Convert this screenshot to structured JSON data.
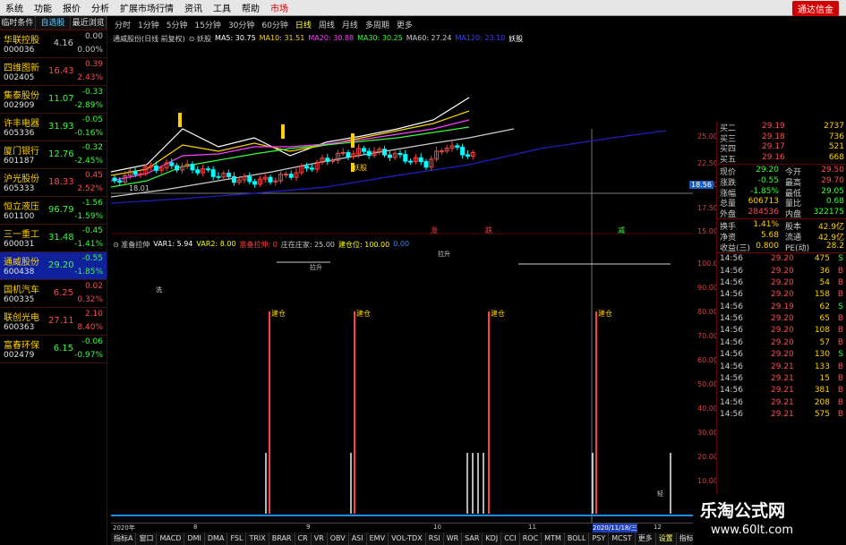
{
  "menu": {
    "items": [
      "系统",
      "功能",
      "报价",
      "分析",
      "扩展市场行情",
      "资讯",
      "工具",
      "帮助"
    ],
    "active": "市场",
    "broker": "通达信金"
  },
  "left_tabs": [
    "临时条件",
    "自选股",
    "最近浏览"
  ],
  "stocks": [
    {
      "name": "华联控股",
      "code": "000036",
      "price": "4.16",
      "change": "0.00",
      "pct": "0.00%",
      "dir": "flat"
    },
    {
      "name": "四维图新",
      "code": "002405",
      "price": "16.43",
      "change": "0.39",
      "pct": "2.43%",
      "dir": "up"
    },
    {
      "name": "集泰股份",
      "code": "002909",
      "price": "11.07",
      "change": "-0.33",
      "pct": "-2.89%",
      "dir": "dn"
    },
    {
      "name": "许丰电器",
      "code": "605336",
      "price": "31.93",
      "change": "-0.05",
      "pct": "-0.16%",
      "dir": "dn"
    },
    {
      "name": "厦门银行",
      "code": "601187",
      "price": "12.76",
      "change": "-0.32",
      "pct": "-2.45%",
      "dir": "dn"
    },
    {
      "name": "沪光股份",
      "code": "605333",
      "price": "18.33",
      "change": "0.45",
      "pct": "2.52%",
      "dir": "up"
    },
    {
      "name": "恒立液压",
      "code": "601100",
      "price": "96.79",
      "change": "-1.56",
      "pct": "-1.59%",
      "dir": "dn"
    },
    {
      "name": "三一重工",
      "code": "600031",
      "price": "31.48",
      "change": "-0.45",
      "pct": "-1.41%",
      "dir": "dn"
    },
    {
      "name": "通威股份",
      "code": "600438",
      "price": "29.20",
      "change": "-0.55",
      "pct": "-1.85%",
      "dir": "dn",
      "selected": true
    },
    {
      "name": "国机汽车",
      "code": "600335",
      "price": "6.25",
      "change": "0.02",
      "pct": "0.32%",
      "dir": "up"
    },
    {
      "name": "联创光电",
      "code": "600363",
      "price": "27.11",
      "change": "2.10",
      "pct": "8.40%",
      "dir": "up"
    },
    {
      "name": "富春环保",
      "code": "002479",
      "price": "6.15",
      "change": "-0.06",
      "pct": "-0.97%",
      "dir": "dn"
    }
  ],
  "periods": [
    "分时",
    "1分钟",
    "5分钟",
    "15分钟",
    "30分钟",
    "60分钟",
    "日线",
    "周线",
    "月线",
    "多周期",
    "更多"
  ],
  "period_active": "日线",
  "ma_legend": [
    {
      "text": "通威股份(日线 前复权)",
      "color": "#cccccc"
    },
    {
      "text": "⊙ 妖股",
      "color": "#cccccc"
    },
    {
      "text": "MA5: 30.75",
      "color": "#ffffff"
    },
    {
      "text": "MA10: 31.51",
      "color": "#ffd100"
    },
    {
      "text": "MA20: 30.88",
      "color": "#ff40ff"
    },
    {
      "text": "MA30: 30.25",
      "color": "#36ff36"
    },
    {
      "text": "MA60: 27.24",
      "color": "#cccccc"
    },
    {
      "text": "MA120: 23.10",
      "color": "#4040ff"
    },
    {
      "text": "妖股",
      "color": "#ffffff"
    }
  ],
  "ind_legend": [
    {
      "text": "⊙ 准备拉伸",
      "color": "#cccccc"
    },
    {
      "text": "VAR1: 5.94",
      "color": "#ffffff"
    },
    {
      "text": "VAR2: 8.00",
      "color": "#ffff00"
    },
    {
      "text": "准备拉伸: 0",
      "color": "#ff4040"
    },
    {
      "text": "庄在庄家: 25.00",
      "color": "#cccccc"
    },
    {
      "text": "建仓位: 100.00",
      "color": "#ffff00"
    },
    {
      "text": "0.00",
      "color": "#4080ff"
    }
  ],
  "chart_labels": {
    "yao": "妖股",
    "low": "18.01",
    "cur": "18.56",
    "jc": "建仓",
    "ind_a": "拉升",
    "ind_b": "拉升",
    "ind_c": "洗",
    "sig_up": "涨",
    "sig_dn": "跌",
    "sig_red": "减",
    "bt": "轻"
  },
  "axis_price": [
    "25.00",
    "22.50",
    "20.00",
    "17.50",
    "15.00"
  ],
  "axis_ind": [
    "100.00",
    "90.00",
    "80.00",
    "70.00",
    "60.00",
    "50.00",
    "40.00",
    "30.00",
    "20.00",
    "10.00"
  ],
  "order_book": [
    {
      "label": "买二",
      "price": "29.19",
      "vol": "2737"
    },
    {
      "label": "买三",
      "price": "29.18",
      "vol": "736"
    },
    {
      "label": "买四",
      "price": "29.17",
      "vol": "521"
    },
    {
      "label": "买五",
      "price": "29.16",
      "vol": "668"
    }
  ],
  "quote": [
    {
      "k1": "现价",
      "v1": "29.20",
      "k2": "今开",
      "v2": "29.50",
      "c1": "#36ff36",
      "c2": "#ff4b4b"
    },
    {
      "k1": "涨跌",
      "v1": "-0.55",
      "k2": "最高",
      "v2": "29.70",
      "c1": "#36ff36",
      "c2": "#ff4b4b"
    },
    {
      "k1": "涨幅",
      "v1": "-1.85%",
      "k2": "最低",
      "v2": "29.05",
      "c1": "#36ff36",
      "c2": "#36ff36"
    },
    {
      "k1": "总量",
      "v1": "606713",
      "k2": "量比",
      "v2": "0.68",
      "c1": "#ffd100",
      "c2": "#36ff36"
    },
    {
      "k1": "外盘",
      "v1": "284536",
      "k2": "内盘",
      "v2": "322175",
      "c1": "#ff4b4b",
      "c2": "#36ff36"
    }
  ],
  "quote2": [
    {
      "k1": "换手",
      "v1": "1.41%",
      "k2": "股本",
      "v2": "42.9亿"
    },
    {
      "k1": "净资",
      "v1": "5.68",
      "k2": "流通",
      "v2": "42.9亿"
    },
    {
      "k1": "收益(三)",
      "v1": "0.800",
      "k2": "PE(动)",
      "v2": "28.2"
    }
  ],
  "ticks": [
    {
      "t": "14:56",
      "p": "29.20",
      "v": "475",
      "bs": "S"
    },
    {
      "t": "14:56",
      "p": "29.20",
      "v": "36",
      "bs": "B"
    },
    {
      "t": "14:56",
      "p": "29.20",
      "v": "54",
      "bs": "B"
    },
    {
      "t": "14:56",
      "p": "29.20",
      "v": "158",
      "bs": "B"
    },
    {
      "t": "14:56",
      "p": "29.19",
      "v": "62",
      "bs": "S"
    },
    {
      "t": "14:56",
      "p": "29.20",
      "v": "65",
      "bs": "B"
    },
    {
      "t": "14:56",
      "p": "29.20",
      "v": "108",
      "bs": "B"
    },
    {
      "t": "14:56",
      "p": "29.20",
      "v": "57",
      "bs": "B"
    },
    {
      "t": "14:56",
      "p": "29.20",
      "v": "130",
      "bs": "S"
    },
    {
      "t": "14:56",
      "p": "29.21",
      "v": "133",
      "bs": "B"
    },
    {
      "t": "14:56",
      "p": "29.21",
      "v": "15",
      "bs": "B"
    },
    {
      "t": "14:56",
      "p": "29.21",
      "v": "381",
      "bs": "B"
    },
    {
      "t": "14:56",
      "p": "29.21",
      "v": "208",
      "bs": "B"
    },
    {
      "t": "14:56",
      "p": "29.21",
      "v": "575",
      "bs": "B"
    }
  ],
  "dates": [
    "2020年",
    "8",
    "9",
    "10",
    "11",
    "2020/11/18/三",
    "12"
  ],
  "indicator_tabs": [
    "指标A",
    "窗口",
    "MACD",
    "DMI",
    "DMA",
    "FSL",
    "TRIX",
    "BRAR",
    "CR",
    "VR",
    "OBV",
    "ASI",
    "EMV",
    "VOL-TDX",
    "RSI",
    "WR",
    "SAR",
    "KDJ",
    "CCI",
    "ROC",
    "MTM",
    "BOLL",
    "PSY",
    "MCST",
    "更多",
    "设置",
    "指标B",
    "模"
  ],
  "indicator_active": "设置",
  "watermark": {
    "title": "乐淘公式网",
    "url": "www.60lt.com"
  }
}
